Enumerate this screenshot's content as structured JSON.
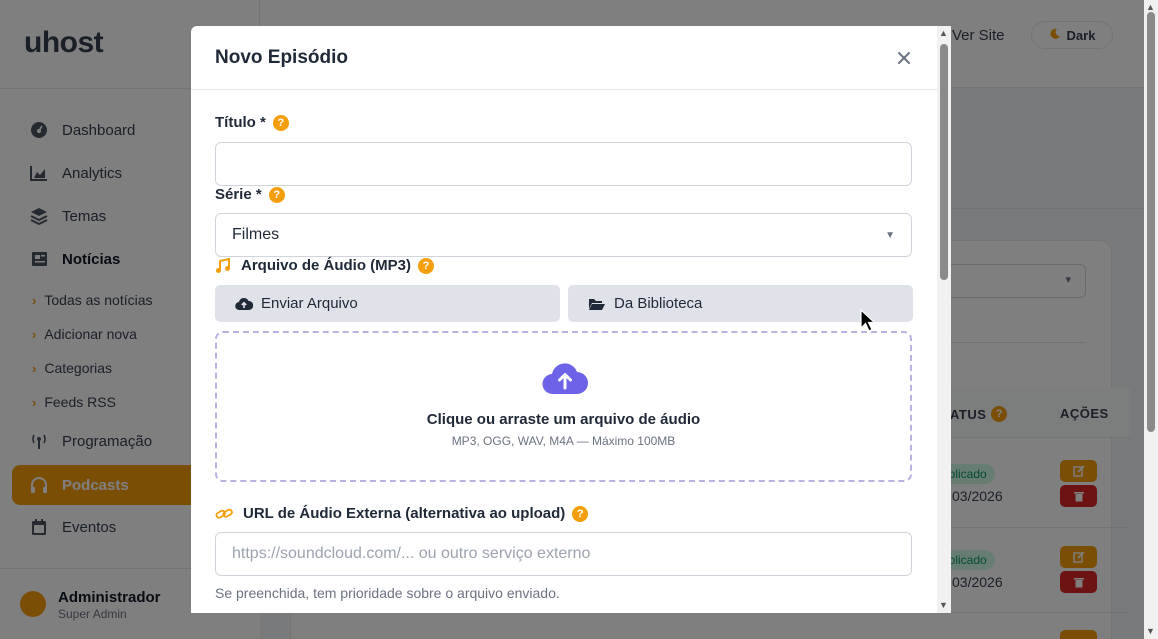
{
  "brand": {
    "logo": "uhost"
  },
  "sidebar": {
    "items": [
      {
        "label": "Dashboard",
        "icon": "gauge-icon"
      },
      {
        "label": "Analytics",
        "icon": "chart-area-icon"
      },
      {
        "label": "Temas",
        "icon": "layers-icon"
      },
      {
        "label": "Notícias",
        "icon": "newspaper-icon"
      }
    ],
    "subitems": [
      {
        "label": "Todas as notícias"
      },
      {
        "label": "Adicionar nova"
      },
      {
        "label": "Categorias"
      },
      {
        "label": "Feeds RSS"
      }
    ],
    "items2": [
      {
        "label": "Programação",
        "icon": "broadcast-icon"
      },
      {
        "label": "Podcasts",
        "icon": "headphones-icon"
      },
      {
        "label": "Eventos",
        "icon": "calendar-icon"
      }
    ],
    "user": {
      "name": "Administrador",
      "role": "Super Admin"
    }
  },
  "topbar": {
    "ver_site": "Ver Site",
    "dark": "Dark"
  },
  "table": {
    "col_status": "ATUS",
    "col_actions": "AÇÕES",
    "rows": [
      {
        "status": "ublicado",
        "date": "03/2026"
      },
      {
        "status": "ublicado",
        "date": "03/2026"
      }
    ]
  },
  "modal": {
    "title": "Novo Episódio",
    "titulo_label": "Título *",
    "titulo_value": "",
    "serie_label": "Série *",
    "serie_value": "Filmes",
    "audio_label": "Arquivo de Áudio (MP3)",
    "tab_upload": "Enviar Arquivo",
    "tab_library": "Da Biblioteca",
    "dropzone_main": "Clique ou arraste um arquivo de áudio",
    "dropzone_sub": "MP3, OGG, WAV, M4A — Máximo 100MB",
    "url_label": "URL de Áudio Externa (alternativa ao upload)",
    "url_placeholder": "https://soundcloud.com/... ou outro serviço externo",
    "url_hint": "Se preenchida, tem prioridade sobre o arquivo enviado.",
    "help_glyph": "?"
  },
  "colors": {
    "accent": "#f59e0b",
    "upload_icon": "#6c63e8",
    "danger": "#dc2626"
  }
}
